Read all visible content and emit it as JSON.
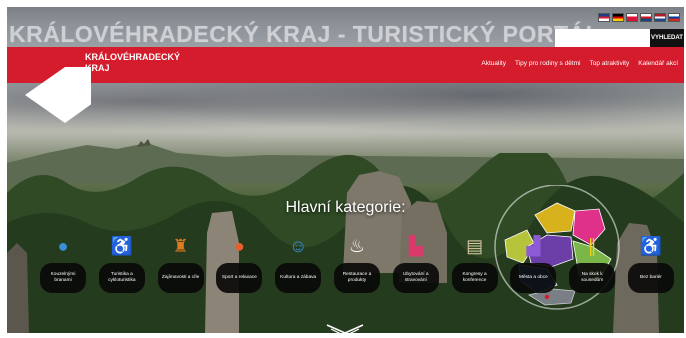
{
  "site": {
    "banner_title": "KRÁLOVÉHRADECKÝ KRAJ - TURISTICKÝ PORTÁL",
    "logo_line1": "KRÁLOVÉHRADECKÝ",
    "logo_line2": "KRAJ"
  },
  "languages": [
    {
      "code": "en",
      "colors": [
        "#1f3a8a",
        "#cf1f2e",
        "#ffffff"
      ]
    },
    {
      "code": "de",
      "colors": [
        "#000000",
        "#dd0000",
        "#ffce00"
      ]
    },
    {
      "code": "pl",
      "colors": [
        "#ffffff",
        "#dc143c",
        "#dc143c"
      ]
    },
    {
      "code": "cz",
      "colors": [
        "#ffffff",
        "#d7141a",
        "#11457e"
      ]
    },
    {
      "code": "nl",
      "colors": [
        "#ae1c28",
        "#ffffff",
        "#21468b"
      ]
    },
    {
      "code": "ru",
      "colors": [
        "#ffffff",
        "#0039a6",
        "#d52b1e"
      ]
    }
  ],
  "search": {
    "placeholder": "",
    "button_label": "VYHLEDAT"
  },
  "nav": {
    "items": [
      "Aktuality",
      "Tipy pro rodiny s dětmi",
      "Top atraktivity",
      "Kalendář akcí"
    ]
  },
  "hero": {
    "heading": "Hlavní kategorie:"
  },
  "categories": [
    {
      "label": "Kouzelnými branami",
      "icon": "globe-icon",
      "color": "#3a8fd6"
    },
    {
      "label": "Turistika a cykloturistika",
      "icon": "bicycle-icon",
      "color": "#e8243a"
    },
    {
      "label": "Zajímavosti a cíle",
      "icon": "castle-icon",
      "color": "#e07a1f"
    },
    {
      "label": "Sport a relaxace",
      "icon": "ball-icon",
      "color": "#e85d2c"
    },
    {
      "label": "Kultura a zábava",
      "icon": "masks-icon",
      "color": "#3a8fd6"
    },
    {
      "label": "Restaurace a produkty",
      "icon": "chef-hat-icon",
      "color": "#ffffff"
    },
    {
      "label": "Ubytování a stravování",
      "icon": "hotel-icon",
      "color": "#d93a6a"
    },
    {
      "label": "Kongresy a konference",
      "icon": "presentation-icon",
      "color": "#d9c9a3"
    },
    {
      "label": "Města a obce",
      "icon": "city-icon",
      "color": "#8e5bd6"
    },
    {
      "label": "Na skok k sousedům",
      "icon": "fence-icon",
      "color": "#f0d21a"
    },
    {
      "label": "Bez bariér",
      "icon": "wheelchair-icon",
      "color": "#3a8fd6"
    }
  ],
  "map": {
    "regions_colors": [
      "#b5c43a",
      "#d7b21c",
      "#e0318a",
      "#6b3ea8",
      "#7ab648",
      "#2f6fc2"
    ]
  }
}
